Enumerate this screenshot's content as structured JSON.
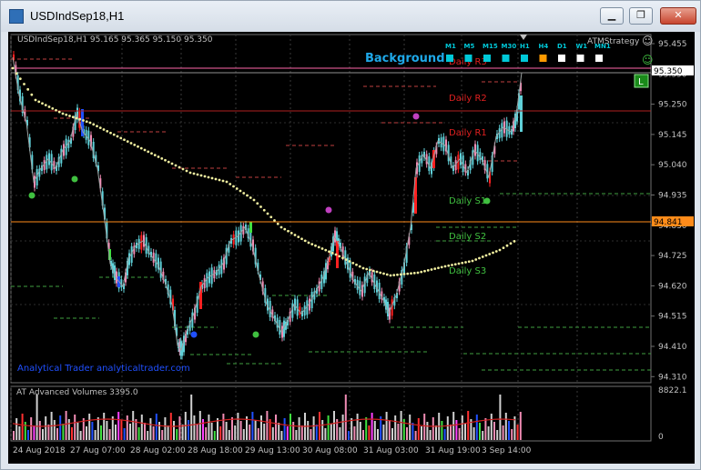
{
  "window": {
    "title": "USDIndSep18,H1",
    "minimize": "▁",
    "restore": "❐",
    "close": "✕"
  },
  "chart": {
    "header": "USDIndSep18,H1  95.165 95.365 95.150 95.350",
    "strategy": "ATMStrategy",
    "background_label": "Background",
    "tf_labels": [
      "M1",
      "M5",
      "M15",
      "M30",
      "H1",
      "H4",
      "D1",
      "W1",
      "MN1"
    ],
    "tf_colors": [
      "#00c8d8",
      "#00c8d8",
      "#00c8d8",
      "#00c8d8",
      "#00c8d8",
      "#ff9a00",
      "#ffffff",
      "#ffffff",
      "#ffffff"
    ],
    "watermark": "Analytical Trader analyticaltrader.com",
    "l_badge": "L",
    "price_axis": [
      "95.455",
      "95.350",
      "95.250",
      "95.145",
      "95.040",
      "94.935",
      "94.830",
      "94.725",
      "94.620",
      "94.515",
      "94.410",
      "94.310"
    ],
    "current_price": "95.350",
    "orange_price": "94.841",
    "pivot_labels": [
      "Daily R3",
      "Daily R2",
      "Daily R1",
      "Daily S1",
      "Daily S2",
      "Daily S3"
    ],
    "volume_title": "AT Advanced Volumes 3395.0",
    "volume_axis_top": "8822.1",
    "volume_axis_bottom": "0",
    "time_axis": [
      "24 Aug 2018",
      "27 Aug 07:00",
      "28 Aug 02:00",
      "28 Aug 18:00",
      "29 Aug 13:00",
      "30 Aug 08:00",
      "31 Aug 03:00",
      "31 Aug 19:00",
      "3 Sep 14:00"
    ]
  },
  "colors": {
    "up_candle": "#5fd0d8",
    "down_candle": "#f08cb4",
    "red_candle": "#ff2020",
    "ma": "#f2f0a0",
    "pivot_red": "#e02020",
    "pivot_green": "#40c040",
    "orange_line": "#ff8c1a",
    "current_line": "#ff66aa"
  }
}
